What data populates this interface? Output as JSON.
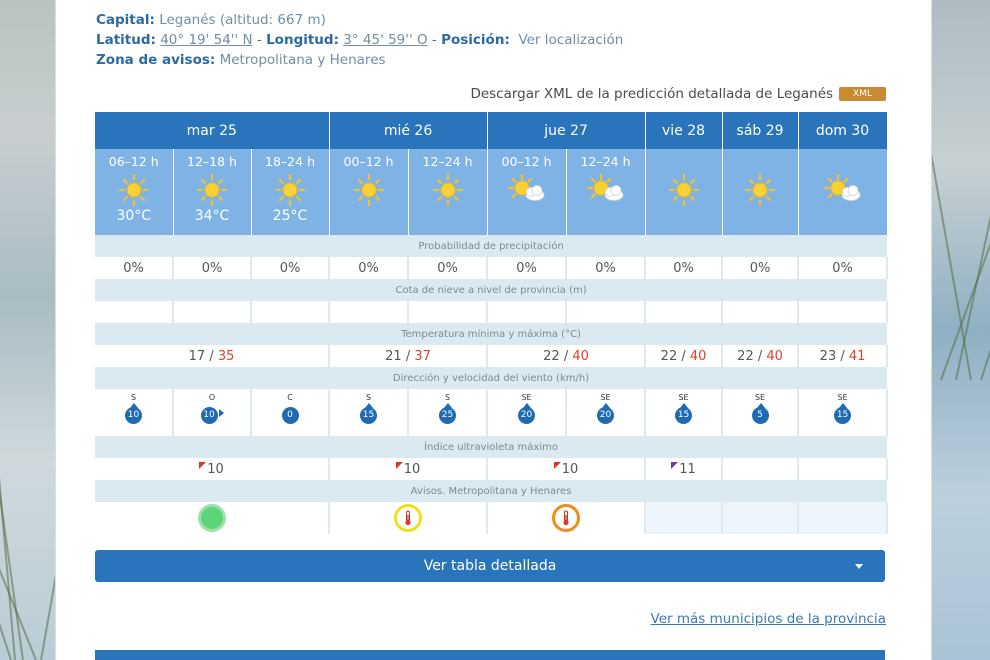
{
  "location": {
    "capital_label": "Capital:",
    "capital_value": "Leganés (altitud: 667 m)",
    "lat_label": "Latitud:",
    "lat_value": "40° 19' 54'' N",
    "lon_label": "Longitud:",
    "lon_value": "3° 45' 59'' O",
    "pos_label": "Posición:",
    "pos_link": "Ver localización",
    "zone_label": "Zona de avisos:",
    "zone_value": "Metropolitana y Henares"
  },
  "xml": {
    "text": "Descargar XML de la predicción detallada de Leganés",
    "badge": "XML"
  },
  "days": [
    {
      "label": "mar 25",
      "span": 3
    },
    {
      "label": "mié 26",
      "span": 2
    },
    {
      "label": "jue 27",
      "span": 2
    },
    {
      "label": "vie 28",
      "span": 1
    },
    {
      "label": "sáb 29",
      "span": 1
    },
    {
      "label": "dom 30",
      "span": 1
    }
  ],
  "periods": [
    {
      "period": "06–12 h",
      "icon": "sun-icon",
      "temp": "30°C"
    },
    {
      "period": "12–18 h",
      "icon": "sun-icon",
      "temp": "34°C"
    },
    {
      "period": "18–24 h",
      "icon": "sun-icon",
      "temp": "25°C"
    },
    {
      "period": "00–12 h",
      "icon": "sun-icon",
      "temp": ""
    },
    {
      "period": "12–24 h",
      "icon": "sun-icon",
      "temp": ""
    },
    {
      "period": "00–12 h",
      "icon": "sun-cloud-icon",
      "temp": ""
    },
    {
      "period": "12–24 h",
      "icon": "sun-cloud-icon",
      "temp": ""
    },
    {
      "period": "",
      "icon": "sun-icon",
      "temp": ""
    },
    {
      "period": "",
      "icon": "sun-icon",
      "temp": ""
    },
    {
      "period": "",
      "icon": "sun-cloud-icon",
      "temp": ""
    }
  ],
  "labels": {
    "precip": "Probabilidad de precipitación",
    "snow": "Cota de nieve a nivel de provincia (m)",
    "temp": "Temperatura mínima y máxima (°C)",
    "wind": "Dirección y velocidad del viento (km/h)",
    "uv": "Índice ultravioleta máximo",
    "warnings": "Avisos. Metropolitana y Henares"
  },
  "precip": [
    "0%",
    "0%",
    "0%",
    "0%",
    "0%",
    "0%",
    "0%",
    "0%",
    "0%",
    "0%"
  ],
  "temps": [
    {
      "min": "17",
      "max": "35"
    },
    {
      "min": "21",
      "max": "37"
    },
    {
      "min": "22",
      "max": "40"
    },
    {
      "min": "22",
      "max": "40"
    },
    {
      "min": "22",
      "max": "40"
    },
    {
      "min": "23",
      "max": "41"
    }
  ],
  "wind": [
    {
      "dir": "S",
      "speed": "10"
    },
    {
      "dir": "O",
      "speed": "10"
    },
    {
      "dir": "C",
      "speed": "0"
    },
    {
      "dir": "S",
      "speed": "15"
    },
    {
      "dir": "S",
      "speed": "25"
    },
    {
      "dir": "SE",
      "speed": "20"
    },
    {
      "dir": "SE",
      "speed": "20"
    },
    {
      "dir": "SE",
      "speed": "15"
    },
    {
      "dir": "SE",
      "speed": "5"
    },
    {
      "dir": "SE",
      "speed": "15"
    }
  ],
  "uv": [
    {
      "value": "10",
      "flag": "#d8392b"
    },
    {
      "value": "10",
      "flag": "#d8392b"
    },
    {
      "value": "10",
      "flag": "#d8392b"
    },
    {
      "value": "11",
      "flag": "#6b3aa8"
    },
    {
      "value": "",
      "flag": ""
    },
    {
      "value": "",
      "flag": ""
    }
  ],
  "warnings": [
    {
      "level": "green",
      "color": "#5ed47a",
      "border": "#9be3a8"
    },
    {
      "level": "yellow",
      "color": "#ffffff",
      "border": "#f2e11b"
    },
    {
      "level": "orange",
      "color": "#ffffff",
      "border": "#ef8c1d"
    }
  ],
  "buttons": {
    "detail": "Ver tabla detallada",
    "more": "Ver más municipios de la provincia"
  }
}
